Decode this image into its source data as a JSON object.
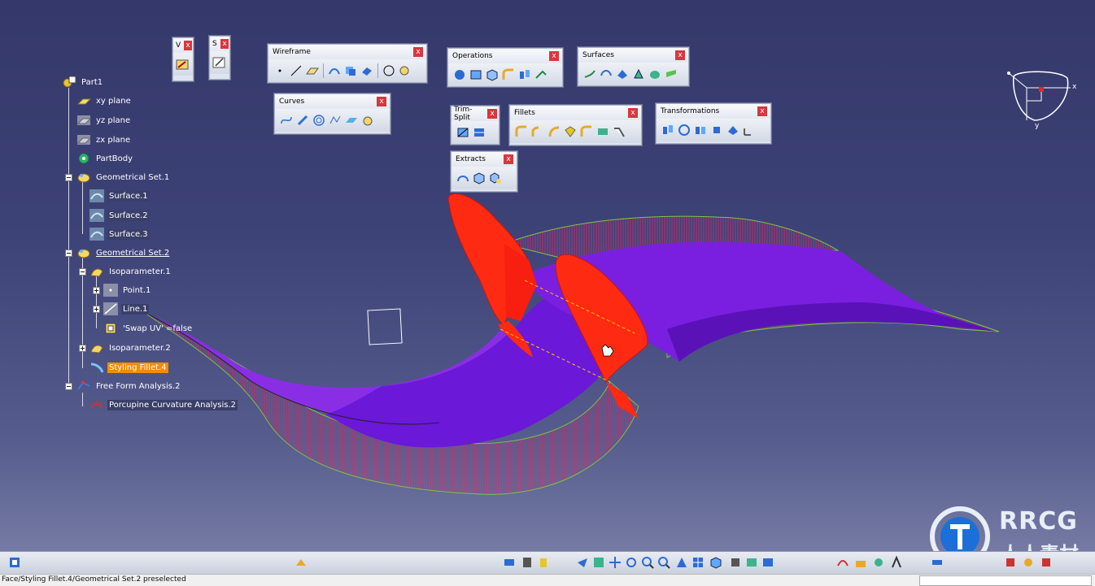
{
  "tree": {
    "root": "Part1",
    "xy_plane": "xy plane",
    "yz_plane": "yz plane",
    "zx_plane": "zx plane",
    "part_body": "PartBody",
    "geo_set_1": "Geometrical Set.1",
    "surface_1": "Surface.1",
    "surface_2": "Surface.2",
    "surface_3": "Surface.3",
    "geo_set_2": "Geometrical Set.2",
    "isoparameter_1": "Isoparameter.1",
    "point_1": "Point.1",
    "line_1": "Line.1",
    "swap_uv": "'Swap UV' =false",
    "isoparameter_2": "Isoparameter.2",
    "styling_fillet": "Styling Fillet.4",
    "ffa": "Free Form Analysis.2",
    "porcupine": "Porcupine Curvature Analysis.2"
  },
  "toolbars": {
    "v_label": "V",
    "s_label": "S",
    "wireframe": "Wireframe",
    "curves": "Curves",
    "operations": "Operations",
    "trim_split": "Trim-Split",
    "extracts": "Extracts",
    "fillets": "Fillets",
    "surfaces": "Surfaces",
    "transformations": "Transformations",
    "close": "x"
  },
  "compass": {
    "x_axis": "x",
    "y_axis": "y"
  },
  "status": {
    "message": "Face/Styling Fillet.4/Geometrical Set.2 preselected"
  },
  "watermark": {
    "logo": "RRCG",
    "subtitle": "人人素材"
  },
  "colors": {
    "background_top": "#34386a",
    "background_bottom": "#7f84ab",
    "surface_purple": "#7a1fe0",
    "fillet_red": "#ff2a12",
    "highlight_orange": "#f28c00"
  }
}
